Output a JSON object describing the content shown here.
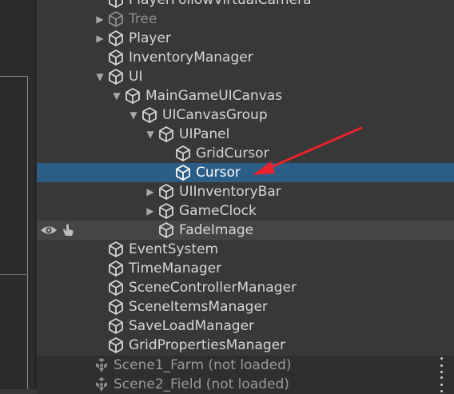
{
  "colors": {
    "background": "#383838",
    "selection": "#2c5d87",
    "annotation_arrow": "#e8232b",
    "scene_row": "#2f2f2f"
  },
  "hierarchy": {
    "items": [
      {
        "label": "PlayerFollowVirtualCamera",
        "depth": 0,
        "expand": "none",
        "dim": false
      },
      {
        "label": "Tree",
        "depth": 0,
        "expand": "collapsed",
        "dim": true
      },
      {
        "label": "Player",
        "depth": 0,
        "expand": "collapsed",
        "dim": false
      },
      {
        "label": "InventoryManager",
        "depth": 0,
        "expand": "none",
        "dim": false
      },
      {
        "label": "UI",
        "depth": 0,
        "expand": "expanded",
        "dim": false
      },
      {
        "label": "MainGameUICanvas",
        "depth": 1,
        "expand": "expanded",
        "dim": false
      },
      {
        "label": "UICanvasGroup",
        "depth": 2,
        "expand": "expanded",
        "dim": false
      },
      {
        "label": "UIPanel",
        "depth": 3,
        "expand": "expanded",
        "dim": false
      },
      {
        "label": "GridCursor",
        "depth": 4,
        "expand": "none",
        "dim": false
      },
      {
        "label": "Cursor",
        "depth": 4,
        "expand": "none",
        "dim": false,
        "selected": true
      },
      {
        "label": "UIInventoryBar",
        "depth": 3,
        "expand": "collapsed",
        "dim": false
      },
      {
        "label": "GameClock",
        "depth": 3,
        "expand": "collapsed",
        "dim": false
      },
      {
        "label": "FadeImage",
        "depth": 3,
        "expand": "none",
        "dim": false,
        "hover": true
      },
      {
        "label": "EventSystem",
        "depth": 0,
        "expand": "none",
        "dim": false
      },
      {
        "label": "TimeManager",
        "depth": 0,
        "expand": "none",
        "dim": false
      },
      {
        "label": "SceneControllerManager",
        "depth": 0,
        "expand": "none",
        "dim": false
      },
      {
        "label": "SceneItemsManager",
        "depth": 0,
        "expand": "none",
        "dim": false
      },
      {
        "label": "SaveLoadManager",
        "depth": 0,
        "expand": "none",
        "dim": false
      },
      {
        "label": "GridPropertiesManager",
        "depth": 0,
        "expand": "none",
        "dim": false
      }
    ],
    "scenes": [
      {
        "label": "Scene1_Farm (not loaded)"
      },
      {
        "label": "Scene2_Field (not loaded)"
      }
    ]
  },
  "icons": {
    "expanded": "triangle-down",
    "collapsed": "triangle-right",
    "gameobject": "cube-icon",
    "scene": "unity-scene-icon",
    "visibility": "eye-icon",
    "pickability": "hand-icon",
    "more": "kebab-menu-icon"
  }
}
